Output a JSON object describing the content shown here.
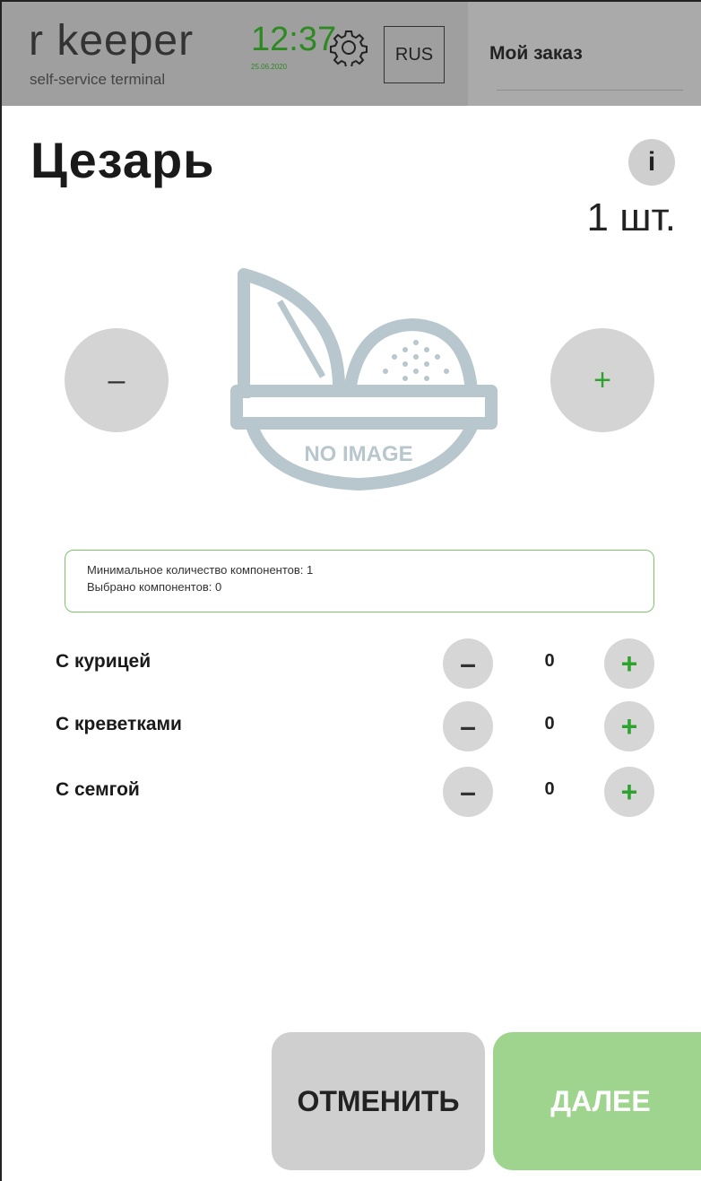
{
  "header": {
    "brand": "r  keeper",
    "brand_sub": "self-service terminal",
    "time": "12:37",
    "date": "25.06.2020",
    "language": "RUS",
    "order_title": "Мой заказ"
  },
  "product": {
    "title": "Цезарь",
    "info_label": "i",
    "quantity": "1 шт.",
    "minus_label": "–",
    "plus_label": "+",
    "image_placeholder": "NO IMAGE"
  },
  "constraints": {
    "min_line": "Минимальное количество компонентов: 1",
    "selected_line": "Выбрано компонентов: 0"
  },
  "components": [
    {
      "name": "С курицей",
      "count": "0",
      "minus": "–",
      "plus": "+"
    },
    {
      "name": "С креветками",
      "count": "0",
      "minus": "–",
      "plus": "+"
    },
    {
      "name": "С семгой",
      "count": "0",
      "minus": "–",
      "plus": "+"
    }
  ],
  "actions": {
    "cancel": "ОТМЕНИТЬ",
    "next": "ДАЛЕЕ"
  },
  "colors": {
    "accent_green": "#2fa12f",
    "next_button": "#9fd48f",
    "header_bg": "#9f9f9f"
  }
}
